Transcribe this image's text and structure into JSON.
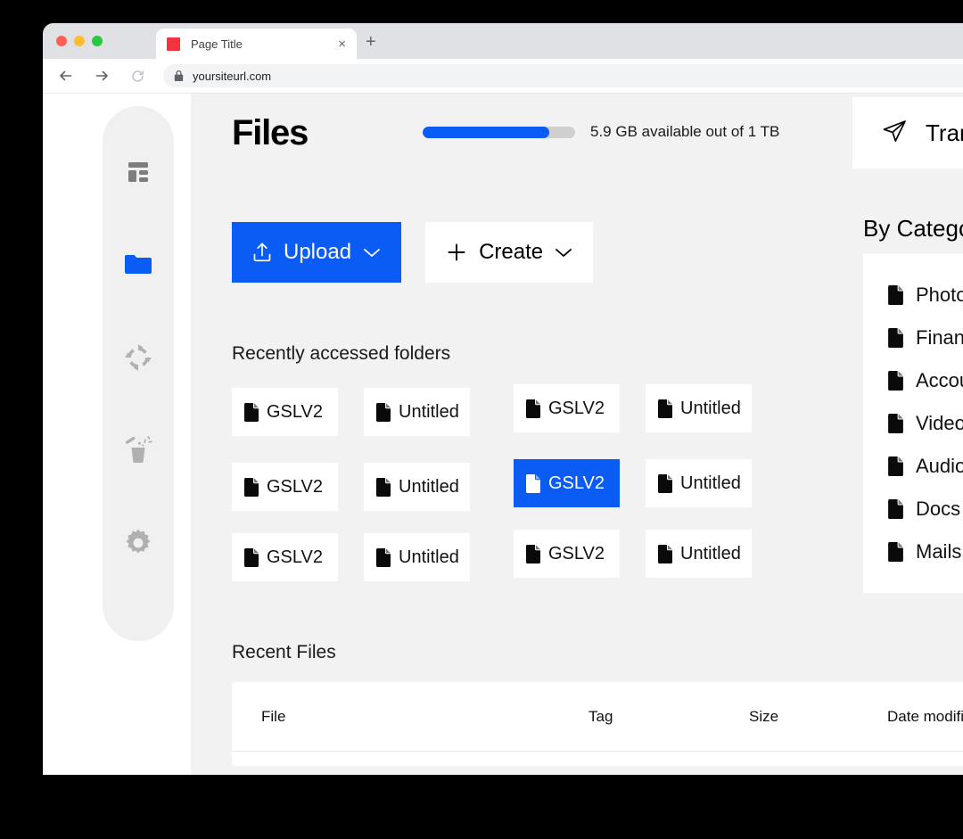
{
  "browser": {
    "tab": {
      "title": "Page Title",
      "favicon": "red-square-favicon",
      "close_label": "×"
    },
    "new_tab_label": "+",
    "nav": {
      "back": "back-arrow",
      "forward": "forward-arrow",
      "reload": "reload-arrow"
    },
    "address": {
      "url": "yoursiteurl.com",
      "lock": "lock-icon"
    }
  },
  "sidebar": {
    "items": [
      {
        "name": "dashboard",
        "active": false
      },
      {
        "name": "files",
        "active": true
      },
      {
        "name": "sync",
        "active": false
      },
      {
        "name": "trash",
        "active": false
      },
      {
        "name": "settings",
        "active": false
      }
    ]
  },
  "header": {
    "title": "Files",
    "storage_text": "5.9 GB available out of 1 TB",
    "storage_percent": 83
  },
  "transfer": {
    "label": "Transfer",
    "icon": "send-icon"
  },
  "toolbar": {
    "upload_label": "Upload",
    "create_label": "Create",
    "chevron": "chevron-down-icon",
    "plus": "plus-icon",
    "upload_icon": "upload-tray-icon"
  },
  "sections": {
    "recent_folders_title": "Recently accessed folders",
    "recent_files_title": "Recent Files"
  },
  "folders": [
    {
      "label": "GSLV2",
      "selected": false,
      "col": 0,
      "row": 0
    },
    {
      "label": "Untitled",
      "selected": false,
      "col": 1,
      "row": 0
    },
    {
      "label": "GSLV2",
      "selected": false,
      "col": 2,
      "row": 0
    },
    {
      "label": "Untitled",
      "selected": false,
      "col": 3,
      "row": 0
    },
    {
      "label": "GSLV2",
      "selected": false,
      "col": 0,
      "row": 1
    },
    {
      "label": "Untitled",
      "selected": false,
      "col": 1,
      "row": 1
    },
    {
      "label": "GSLV2",
      "selected": true,
      "col": 2,
      "row": 1
    },
    {
      "label": "Untitled",
      "selected": false,
      "col": 3,
      "row": 1
    },
    {
      "label": "GSLV2",
      "selected": false,
      "col": 0,
      "row": 2
    },
    {
      "label": "Untitled",
      "selected": false,
      "col": 1,
      "row": 2
    },
    {
      "label": "GSLV2",
      "selected": false,
      "col": 2,
      "row": 2
    },
    {
      "label": "Untitled",
      "selected": false,
      "col": 3,
      "row": 2
    }
  ],
  "category": {
    "title": "By Category",
    "items": [
      {
        "label": "Photos"
      },
      {
        "label": "Finance"
      },
      {
        "label": "Accounts"
      },
      {
        "label": "Videos"
      },
      {
        "label": "Audio"
      },
      {
        "label": "Docs"
      },
      {
        "label": "Mails"
      }
    ]
  },
  "recent_files_table": {
    "columns": [
      "File",
      "Tag",
      "Size",
      "Date modified"
    ],
    "rows": []
  },
  "colors": {
    "accent": "#0b5cf5",
    "content_bg": "#f2f2f2",
    "card_bg": "#ffffff",
    "rail_bg": "#f0f0f0",
    "icon_gray": "#a3a3a3",
    "tab_strip": "#dfe1e5"
  }
}
